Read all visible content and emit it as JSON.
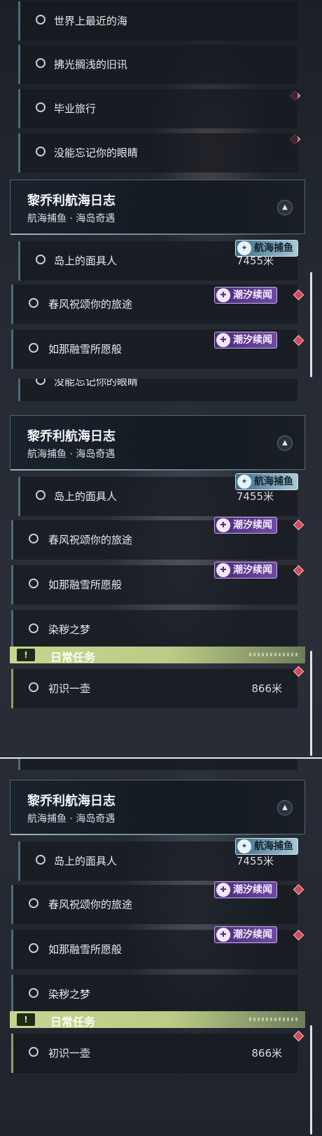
{
  "panel1": {
    "rows": [
      {
        "label": "世界上最近的海"
      },
      {
        "label": "拂光搁浅的旧讯"
      },
      {
        "label": "毕业旅行"
      },
      {
        "label": "没能忘记你的眼睛"
      }
    ],
    "header": {
      "title": "黎乔利航海日志",
      "subtitle": "航海捕鱼 · 海岛奇遇"
    },
    "island_row": {
      "label": "岛上的面具人",
      "distance": "7455米",
      "tag": "航海捕鱼"
    },
    "tide_rows": [
      {
        "label": "春风祝颂你的旅途",
        "tag": "潮汐续闻"
      },
      {
        "label": "如那融雪所愿般",
        "tag": "潮汐续闻"
      }
    ]
  },
  "panel2": {
    "top_row": {
      "label": "没能忘记你的眼睛"
    },
    "header": {
      "title": "黎乔利航海日志",
      "subtitle": "航海捕鱼 · 海岛奇遇"
    },
    "island_row": {
      "label": "岛上的面具人",
      "distance": "7455米",
      "tag": "航海捕鱼"
    },
    "tide_rows": [
      {
        "label": "春风祝颂你的旅途",
        "tag": "潮汐续闻"
      },
      {
        "label": "如那融雪所愿般",
        "tag": "潮汐续闻"
      }
    ],
    "plain_row": {
      "label": "染秽之梦"
    },
    "daily": {
      "icon": "!",
      "label": "日常任务"
    },
    "daily_row": {
      "label": "初识一壶",
      "distance": "866米"
    }
  },
  "panel3": {
    "header": {
      "title": "黎乔利航海日志",
      "subtitle": "航海捕鱼 · 海岛奇遇"
    },
    "island_row": {
      "label": "岛上的面具人",
      "distance": "7455米",
      "tag": "航海捕鱼"
    },
    "tide_rows": [
      {
        "label": "春风祝颂你的旅途",
        "tag": "潮汐续闻"
      },
      {
        "label": "如那融雪所愿般",
        "tag": "潮汐续闻"
      }
    ],
    "plain_row": {
      "label": "染秽之梦"
    },
    "daily": {
      "icon": "!",
      "label": "日常任务"
    },
    "daily_row": {
      "label": "初识一壶",
      "distance": "866米"
    }
  },
  "icons": {
    "collapse": "chevron-up-icon",
    "fish_tag": "fishing-icon",
    "tide_tag": "tide-icon",
    "alert": "exclamation-icon",
    "marker": "red-diamond-icon"
  },
  "colors": {
    "tide_tag": "#5a3490",
    "fish_tag": "#7fb0c8",
    "daily_bar": "#c6d68f",
    "marker": "#d04a5a"
  }
}
